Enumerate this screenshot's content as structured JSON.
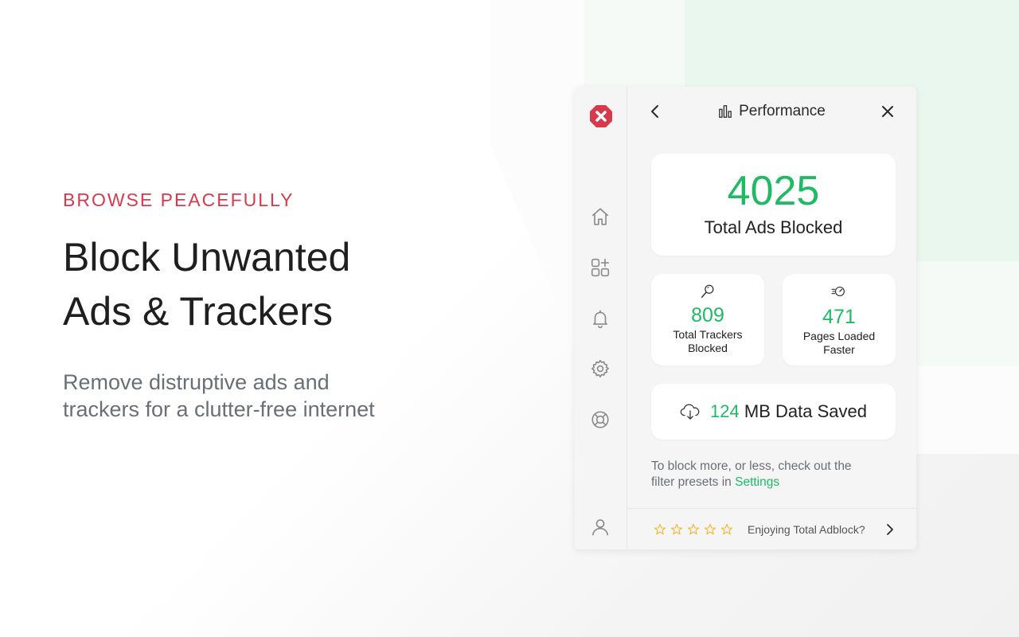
{
  "hero": {
    "eyebrow": "BROWSE PEACEFULLY",
    "headline_line1": "Block Unwanted",
    "headline_line2": "Ads & Trackers",
    "sub_line1": "Remove distruptive ads and",
    "sub_line2": "trackers for a clutter-free internet"
  },
  "popup": {
    "sidebar": {
      "icons": [
        "logo-x-icon",
        "home-icon",
        "apps-add-icon",
        "bell-icon",
        "gear-icon",
        "lifebuoy-icon",
        "user-icon"
      ]
    },
    "header": {
      "title": "Performance",
      "icon": "bar-chart-icon"
    },
    "stats": {
      "ads_blocked_value": "4025",
      "ads_blocked_label": "Total Ads Blocked",
      "trackers_value": "809",
      "trackers_label_line1": "Total Trackers",
      "trackers_label_line2": "Blocked",
      "pages_value": "471",
      "pages_label_line1": "Pages Loaded",
      "pages_label_line2": "Faster",
      "data_saved_value": "124",
      "data_saved_label": "MB Data Saved"
    },
    "hint": {
      "text_line1": "To block more, or less, check out the",
      "text_line2": "filter presets in ",
      "link": "Settings"
    },
    "footer": {
      "rating_max": 5,
      "rating_value": 0,
      "prompt": "Enjoying Total Adblock?"
    }
  },
  "colors": {
    "accent_red": "#d83a4d",
    "accent_green": "#1fba63",
    "star_yellow": "#f2b632"
  }
}
